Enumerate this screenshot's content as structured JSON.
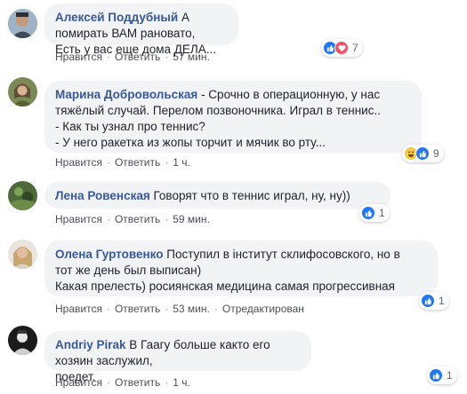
{
  "labels": {
    "like": "Нравится",
    "reply": "Ответить",
    "separator": "·"
  },
  "colors": {
    "author": "#385898",
    "bubble": "#f2f3f5",
    "like": "#2078f4",
    "love": "#f25268",
    "haha": "#f7c843"
  },
  "comments": [
    {
      "author": "Алексей Поддубный",
      "lines": [
        "А помирать ВАМ рановато,",
        "Есть у вас еще дома ДЕЛА..."
      ],
      "reactions": [
        "like-icon",
        "love-icon"
      ],
      "reaction_count": "7",
      "time": "57 мин."
    },
    {
      "author": "Марина Добровольская",
      "lines": [
        "- Срочно в операционную, у нас",
        "тяжёлый случай. Перелом позвоночника. Играл в теннис..",
        "- Как ты узнал про теннис?",
        "- У него ракетка из жопы торчит и мячик во рту..."
      ],
      "reactions": [
        "haha-icon",
        "like-icon"
      ],
      "reaction_count": "9",
      "time": "1 ч."
    },
    {
      "author": "Лена Ровенская",
      "lines": [
        "Говорят что в теннис играл, ну, ну))"
      ],
      "reactions": [
        "like-icon"
      ],
      "reaction_count": "1",
      "time": "59 мин."
    },
    {
      "author": "Олена Гуртовенко",
      "lines": [
        "Поступил в інститут склифосовского, но в",
        "тот же день был выписан)",
        "Какая прелесть) росиянская медицина самая прогрессивная"
      ],
      "reactions": [
        "like-icon"
      ],
      "reaction_count": "1",
      "time": "53 мин.",
      "edited": "Отредактирован"
    },
    {
      "author": "Andriy Pirak",
      "lines": [
        "В Гаагу больше както его хозяин заслужил,",
        "поедет."
      ],
      "reactions": [
        "like-icon"
      ],
      "reaction_count": "1",
      "time": "1 ч."
    }
  ]
}
